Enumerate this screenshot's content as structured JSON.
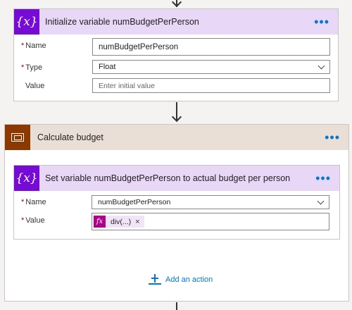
{
  "init_card": {
    "title": "Initialize variable numBudgetPerPerson",
    "menu_label": "•••",
    "name_label": "Name",
    "name_value": "numBudgetPerPerson",
    "type_label": "Type",
    "type_value": "Float",
    "value_label": "Value",
    "value_placeholder": "Enter initial value",
    "icon_text": "{x}"
  },
  "scope_card": {
    "title": "Calculate budget",
    "menu_label": "•••",
    "add_action_label": "Add an action"
  },
  "set_card": {
    "title": "Set variable numBudgetPerPerson to actual budget per person",
    "menu_label": "•••",
    "name_label": "Name",
    "name_value": "numBudgetPerPerson",
    "value_label": "Value",
    "token_icon": "fx",
    "token_text": "div(...)",
    "token_remove": "×",
    "icon_text": "{x}"
  },
  "required_marker": "*",
  "colors": {
    "variable_accent": "#770bd6",
    "variable_header": "#e8d7f6",
    "scope_accent": "#8c3900",
    "scope_header": "#eadfd6",
    "expression_accent": "#ad008c",
    "link": "#0078d4"
  }
}
